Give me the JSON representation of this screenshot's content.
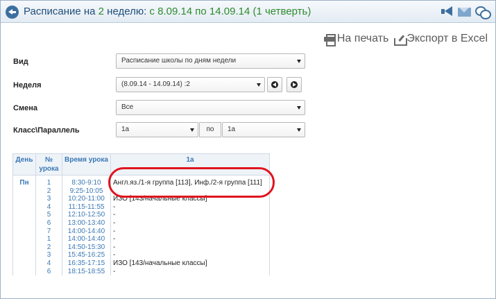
{
  "header": {
    "title_prefix": "Расписание на ",
    "week_number": "2",
    "title_middle": " неделю: ",
    "date_range": "с 8.09.14 по 14.09.14 (1 четверть)"
  },
  "actions": {
    "print_label": "На печать",
    "export_label": "Экспорт в Excel"
  },
  "form": {
    "view": {
      "label": "Вид",
      "value": "Расписание школы по дням недели"
    },
    "week": {
      "label": "Неделя",
      "value": "(8.09.14 - 14.09.14) :2"
    },
    "shift": {
      "label": "Смена",
      "value": "Все"
    },
    "class": {
      "label": "Класс\\Параллель",
      "from_value": "1а",
      "separator": "по",
      "to_value": "1а"
    }
  },
  "table": {
    "columns": [
      "День",
      "№ урока",
      "Время урока",
      "1а"
    ],
    "day": "Пн",
    "rows": [
      {
        "num": "1",
        "time": "8:30-9:10",
        "subject": "Англ.яз./1-я группа [113], Инф./2-я группа [111]"
      },
      {
        "num": "2",
        "time": "9:25-10:05",
        "subject": ""
      },
      {
        "num": "3",
        "time": "10:20-11:00",
        "subject": "ИЗО [143/начальные классы]"
      },
      {
        "num": "4",
        "time": "11:15-11:55",
        "subject": "-"
      },
      {
        "num": "5",
        "time": "12:10-12:50",
        "subject": "-"
      },
      {
        "num": "6",
        "time": "13:00-13:40",
        "subject": "-"
      },
      {
        "num": "7",
        "time": "14:00-14:40",
        "subject": "-"
      },
      {
        "num": "1",
        "time": "14:00-14:40",
        "subject": "-"
      },
      {
        "num": "2",
        "time": "14:50-15:30",
        "subject": "-"
      },
      {
        "num": "3",
        "time": "15:45-16:25",
        "subject": "-"
      },
      {
        "num": "4",
        "time": "16:35-17:15",
        "subject": "ИЗО [143/начальные классы]"
      },
      {
        "num": "6",
        "time": "18:15-18:55",
        "subject": "-"
      }
    ]
  },
  "colors": {
    "accent": "#3a78b5",
    "title": "#1f4e7a",
    "highlight_green": "#2e8b2e",
    "annotation_red": "#e0141e"
  }
}
